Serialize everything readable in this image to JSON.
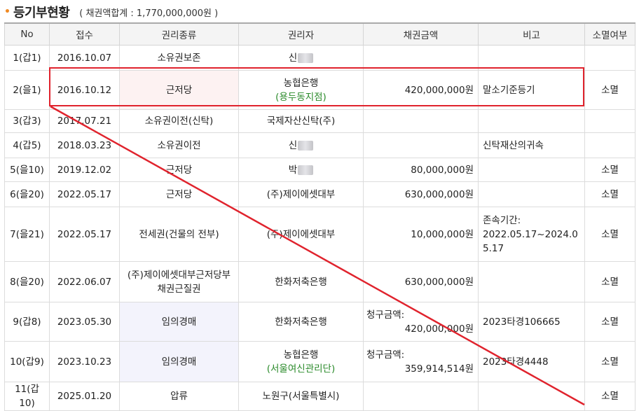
{
  "header": {
    "title": "등기부현황",
    "total": "( 채권액합계 : 1,770,000,000원 )"
  },
  "columns": [
    "No",
    "접수",
    "권리종류",
    "권리자",
    "채권금액",
    "비고",
    "소멸여부"
  ],
  "rows": [
    {
      "no": "1(갑1)",
      "date": "2016.10.07",
      "type": "소유권보존",
      "holder": "신",
      "holder_blur": true,
      "holder_sub": "",
      "amount_label": "",
      "amount": "",
      "note": "",
      "status": ""
    },
    {
      "no": "2(을1)",
      "date": "2016.10.12",
      "type": "근저당",
      "holder": "농협은행",
      "holder_blur": false,
      "holder_sub": "(용두동지점)",
      "amount_label": "",
      "amount": "420,000,000원",
      "note": "말소기준등기",
      "status": "소멸"
    },
    {
      "no": "3(갑3)",
      "date": "2017.07.21",
      "type": "소유권이전(신탁)",
      "holder": "국제자산신탁(주)",
      "holder_blur": false,
      "holder_sub": "",
      "amount_label": "",
      "amount": "",
      "note": "",
      "status": ""
    },
    {
      "no": "4(갑5)",
      "date": "2018.03.23",
      "type": "소유권이전",
      "holder": "신",
      "holder_blur": true,
      "holder_sub": "",
      "amount_label": "",
      "amount": "",
      "note": "신탁재산의귀속",
      "status": ""
    },
    {
      "no": "5(을10)",
      "date": "2019.12.02",
      "type": "근저당",
      "holder": "박",
      "holder_blur": true,
      "holder_sub": "",
      "amount_label": "",
      "amount": "80,000,000원",
      "note": "",
      "status": "소멸"
    },
    {
      "no": "6(을20)",
      "date": "2022.05.17",
      "type": "근저당",
      "holder": "(주)제이에셋대부",
      "holder_blur": false,
      "holder_sub": "",
      "amount_label": "",
      "amount": "630,000,000원",
      "note": "",
      "status": "소멸"
    },
    {
      "no": "7(을21)",
      "date": "2022.05.17",
      "type": "전세권(건물의 전부)",
      "holder": "(주)제이에셋대부",
      "holder_blur": false,
      "holder_sub": "",
      "amount_label": "",
      "amount": "10,000,000원",
      "note": "존속기간:\n2022.05.17~2024.0\n5.17",
      "status": "소멸"
    },
    {
      "no": "8(을20)",
      "date": "2022.06.07",
      "type": "(주)제이에셋대부근저당부\n채권근질권",
      "holder": "한화저축은행",
      "holder_blur": false,
      "holder_sub": "",
      "amount_label": "",
      "amount": "630,000,000원",
      "note": "",
      "status": "소멸"
    },
    {
      "no": "9(갑8)",
      "date": "2023.05.30",
      "type": "임의경매",
      "holder": "한화저축은행",
      "holder_blur": false,
      "holder_sub": "",
      "amount_label": "청구금액:",
      "amount": "420,000,000원",
      "note": "2023타경106665",
      "status": "소멸"
    },
    {
      "no": "10(갑9)",
      "date": "2023.10.23",
      "type": "임의경매",
      "holder": "농협은행",
      "holder_blur": false,
      "holder_sub": "(서울여신관리단)",
      "amount_label": "청구금액:",
      "amount": "359,914,514원",
      "note": "2023타경4448",
      "status": "소멸"
    },
    {
      "no": "11(갑10)",
      "date": "2025.01.20",
      "type": "압류",
      "holder": "노원구(서울특별시)",
      "holder_blur": false,
      "holder_sub": "",
      "amount_label": "",
      "amount": "",
      "note": "",
      "status": "소멸"
    }
  ],
  "row_bg": [
    "",
    "pink",
    "",
    "",
    "",
    "",
    "",
    "",
    "lav",
    "lav",
    ""
  ],
  "annotation_color": "#e0232d"
}
